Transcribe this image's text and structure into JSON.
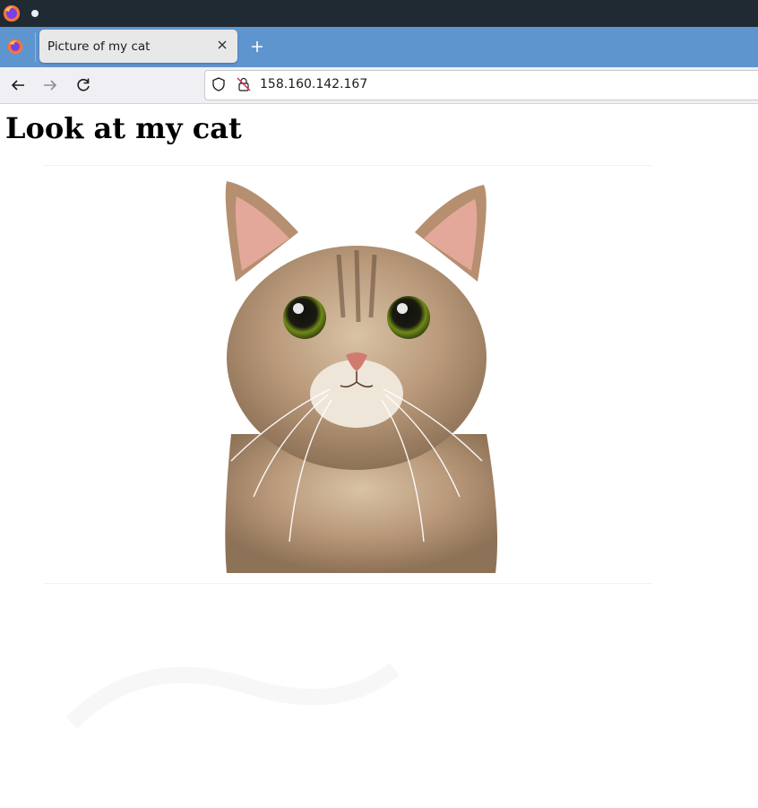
{
  "browser": {
    "tab_title": "Picture of my cat",
    "url": "158.160.142.167",
    "icons": {
      "app": "firefox-icon",
      "tab_close": "close-icon",
      "new_tab": "plus-icon",
      "back": "back-arrow-icon",
      "forward": "forward-arrow-icon",
      "reload": "reload-icon",
      "tracking": "shield-icon",
      "security": "insecure-lock-icon"
    }
  },
  "page": {
    "heading": "Look at my cat",
    "image_label": "cat-photo"
  },
  "colors": {
    "titlebar": "#1f2a33",
    "tabbar": "#5f95cf",
    "tab_active": "#e8e8e8",
    "navbar": "#f0f0f4"
  }
}
